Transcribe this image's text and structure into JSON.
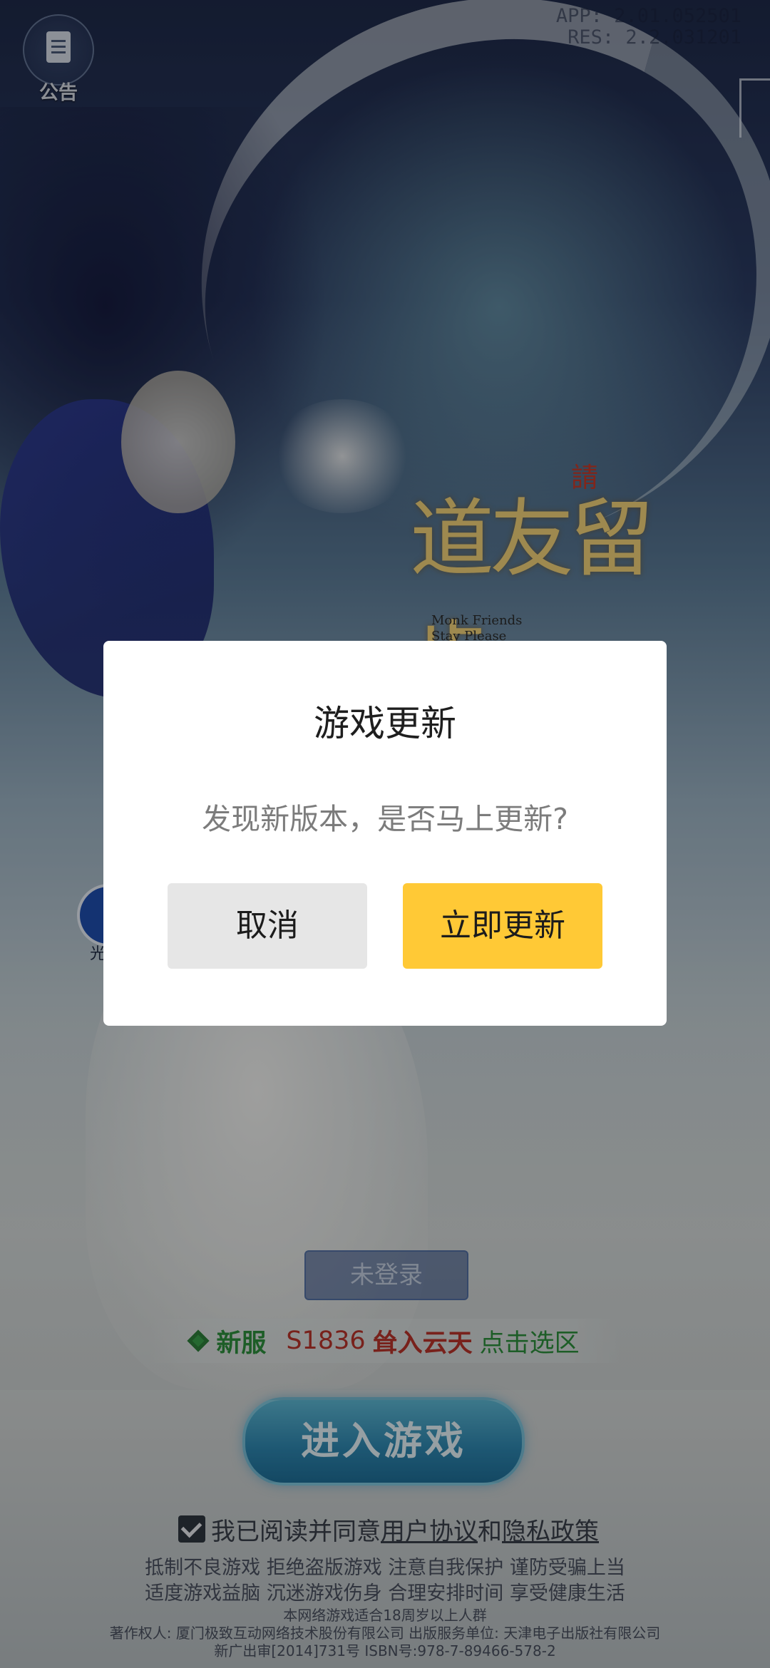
{
  "top": {
    "notice_label": "公告",
    "version_app": "APP: 2.01.052501",
    "version_res": "RES: 2.2.031201"
  },
  "logo": {
    "main": "道友留步",
    "seal": "請",
    "en_line1": "Monk Friends",
    "en_line2": "Stay Please"
  },
  "side_badge_text": "光",
  "login": {
    "status": "未登录"
  },
  "server": {
    "new_label": "新服",
    "id": "S1836",
    "name": "耸入云天",
    "select_label": "点击选区"
  },
  "enter_button": "进入游戏",
  "agreement": {
    "prefix": "我已阅读并同意",
    "user_agreement": "用户协议",
    "and": "和",
    "privacy_policy": "隐私政策"
  },
  "footer": {
    "line1": "抵制不良游戏 拒绝盗版游戏 注意自我保护 谨防受骗上当",
    "line2": "适度游戏益脑 沉迷游戏伤身 合理安排时间 享受健康生活",
    "line3": "本网络游戏适合18周岁以上人群",
    "line4": "著作权人: 厦门极致互动网络技术股份有限公司 出版服务单位: 天津电子出版社有限公司",
    "line5": "新广出审[2014]731号  ISBN号:978-7-89466-578-2"
  },
  "modal": {
    "title": "游戏更新",
    "message": "发现新版本，是否马上更新?",
    "cancel": "取消",
    "confirm": "立即更新"
  },
  "colors": {
    "modal_confirm": "#ffc936",
    "modal_cancel": "#e6e6e6",
    "server_new": "#2d8f3c",
    "server_name": "#b8342a"
  }
}
